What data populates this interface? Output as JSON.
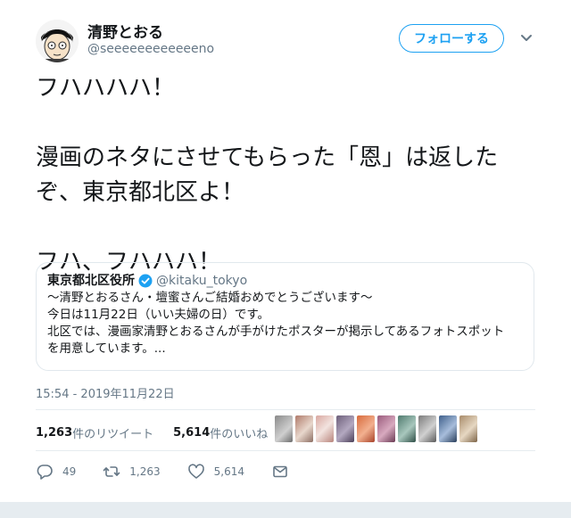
{
  "author": {
    "name": "清野とおる",
    "handle": "@seeeeeeeeeeeeno",
    "follow_label": "フォローする"
  },
  "tweet_text": "フハハハハ！\n\n漫画のネタにさせてもらった「恩」は返した\nぞ、東京都北区よ！\n\nフハ、フハハハ！",
  "quote": {
    "name": "東京都北区役所",
    "handle": "@kitaku_tokyo",
    "body": "～清野とおるさん・壇蜜さんご結婚おめでとうございます～\n今日は11月22日（いい夫婦の日）です。\n北区では、漫画家清野とおるさんが手がけたポスターが掲示してあるフォトスポット\nを用意しています。..."
  },
  "timestamp": "15:54 - 2019年11月22日",
  "stats": {
    "retweets_num": "1,263",
    "retweets_label": "件のリツイート",
    "likes_num": "5,614",
    "likes_label": "件のいいね"
  },
  "actions": {
    "reply_count": "49",
    "retweet_count": "1,263",
    "like_count": "5,614"
  },
  "icons": [
    "reply-icon",
    "retweet-icon",
    "heart-icon",
    "message-icon",
    "verified-icon",
    "chevron-down-icon"
  ],
  "colors": {
    "accent": "#1da1f2",
    "secondary_text": "#657786",
    "border": "#e1e8ed"
  }
}
